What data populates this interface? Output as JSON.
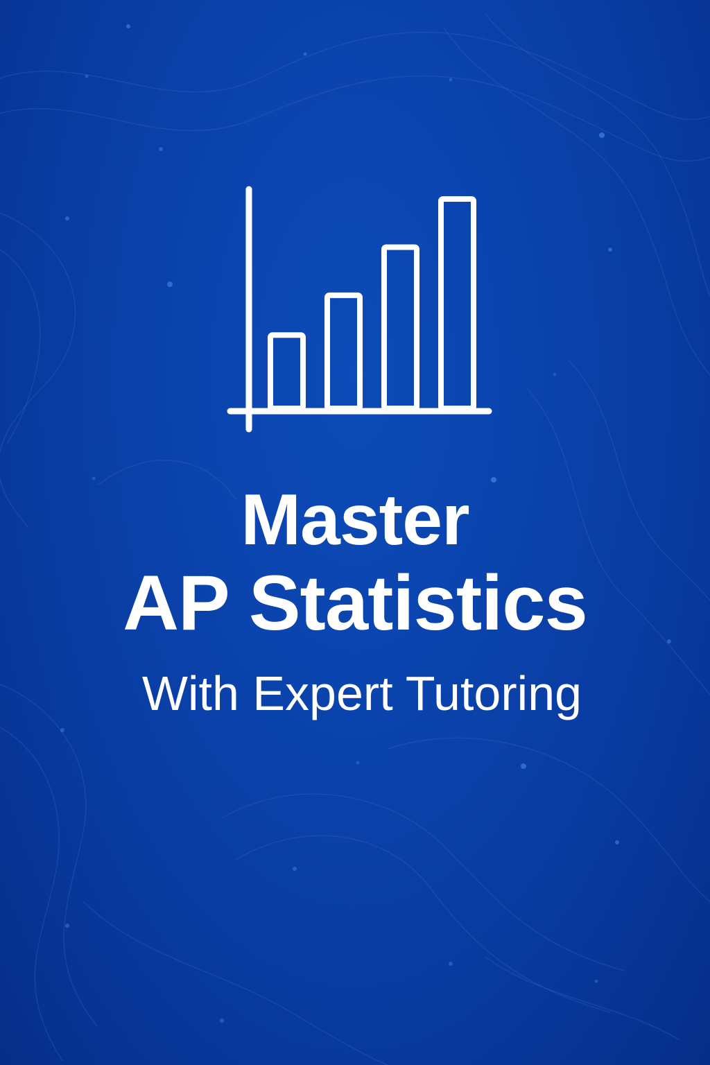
{
  "headline": {
    "line1": "Master",
    "line2": "AP Statistics"
  },
  "subtitle": "With Expert Tutoring",
  "icon": {
    "name": "bar-chart-icon",
    "bar_levels": [
      0.35,
      0.54,
      0.77,
      1.0
    ]
  },
  "colors": {
    "background": "#0a42ab",
    "text": "#ffffff",
    "contour": "#3d6fd0"
  }
}
